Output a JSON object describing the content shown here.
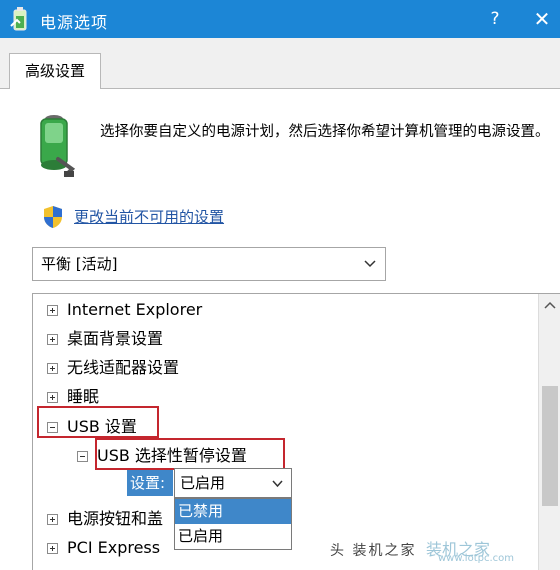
{
  "window": {
    "title": "电源选项",
    "help_label": "?",
    "close_label": "✕"
  },
  "tab": {
    "label": "高级设置"
  },
  "header": {
    "description": "选择你要自定义的电源计划，然后选择你希望计算机管理的电源设置。",
    "change_link": "更改当前不可用的设置"
  },
  "plan_select": {
    "value": "平衡 [活动]"
  },
  "tree": {
    "items": [
      {
        "label": "Internet Explorer",
        "state": "collapsed"
      },
      {
        "label": "桌面背景设置",
        "state": "collapsed"
      },
      {
        "label": "无线适配器设置",
        "state": "collapsed"
      },
      {
        "label": "睡眠",
        "state": "collapsed"
      },
      {
        "label": "USB 设置",
        "state": "expanded"
      },
      {
        "label": "USB 选择性暂停设置",
        "state": "expanded"
      },
      {
        "label": "电源按钮和盖",
        "state": "collapsed"
      },
      {
        "label": "PCI Express",
        "state": "collapsed"
      }
    ],
    "setting_label": "设置:",
    "setting_value": "已启用"
  },
  "dropdown": {
    "options": [
      "已禁用",
      "已启用"
    ],
    "highlighted": "已禁用"
  },
  "colors": {
    "titlebar": "#1c86d6",
    "highlight": "#3f87c9",
    "link": "#2255a4",
    "red_frame": "#c4262e"
  },
  "watermark": {
    "left_text": "头 装机之家",
    "right_text": "装机之家",
    "url": "www.lotpc.com"
  }
}
